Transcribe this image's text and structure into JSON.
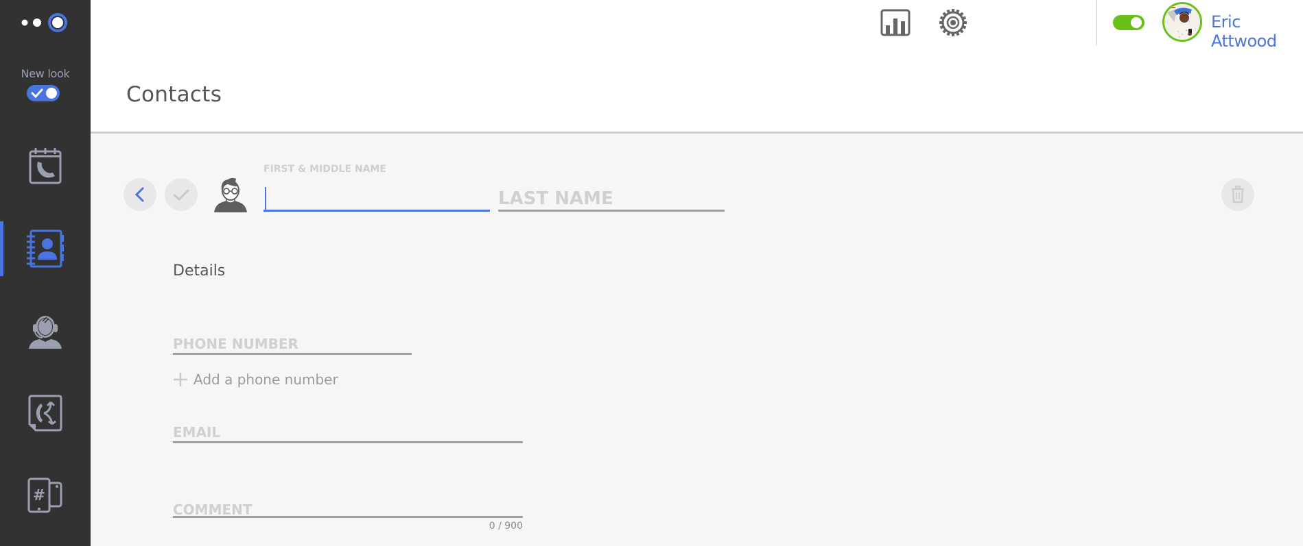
{
  "sidebar": {
    "new_look_label": "New look",
    "new_look_enabled": true,
    "items": [
      {
        "id": "calls",
        "icon": "calendar-phone-icon",
        "active": false
      },
      {
        "id": "contacts",
        "icon": "address-book-icon",
        "active": true
      },
      {
        "id": "agent",
        "icon": "headset-agent-icon",
        "active": false
      },
      {
        "id": "call-routing",
        "icon": "call-routing-icon",
        "active": false
      },
      {
        "id": "numbers",
        "icon": "phone-numbers-icon",
        "active": false
      }
    ]
  },
  "topbar": {
    "stats_icon": "bar-chart-icon",
    "settings_icon": "gear-icon",
    "status_available": true,
    "user_name": "Eric Attwood",
    "dialpad_icon": "dialpad-icon"
  },
  "page": {
    "title": "Contacts"
  },
  "contact_form": {
    "first_name_label": "FIRST & MIDDLE NAME",
    "first_name_value": "",
    "last_name_placeholder": "LAST NAME",
    "last_name_value": "",
    "details_title": "Details",
    "phone_placeholder": "PHONE NUMBER",
    "add_phone_label": "Add a phone number",
    "email_placeholder": "EMAIL",
    "comment_placeholder": "COMMENT",
    "comment_counter": "0 / 900"
  },
  "colors": {
    "accent": "#4a74e0",
    "status_green": "#6abf18",
    "sidebar_bg": "#323232",
    "icon_inactive": "#9aa0b0"
  }
}
